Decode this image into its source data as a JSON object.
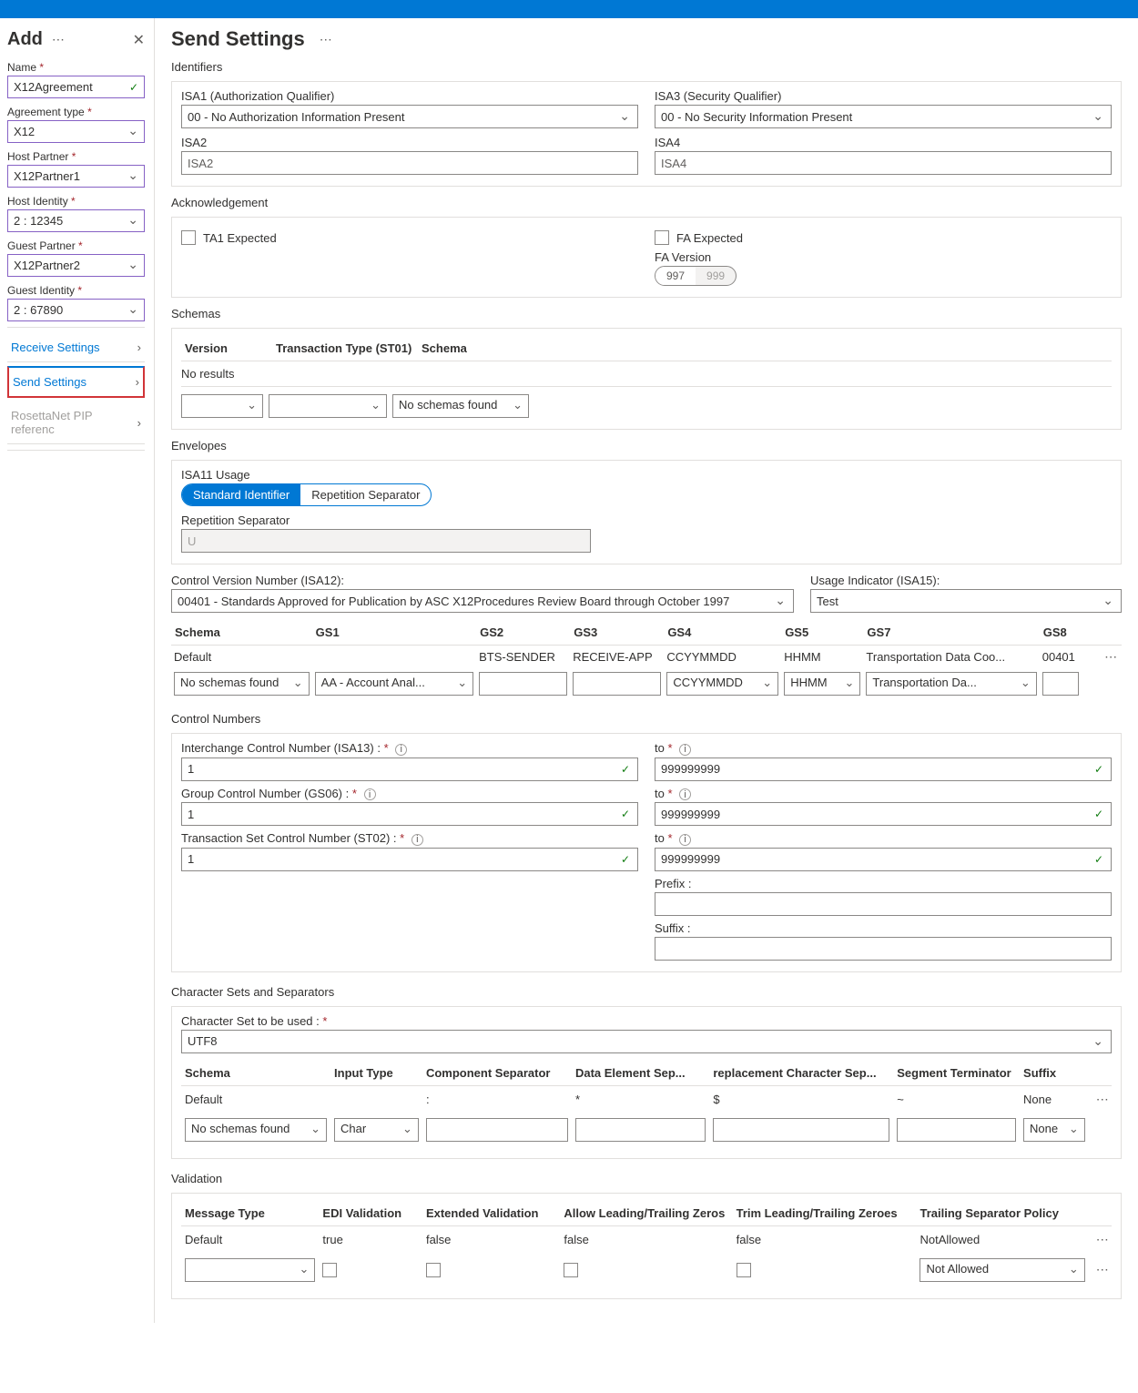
{
  "sidebar": {
    "title": "Add",
    "fields": {
      "name_label": "Name",
      "name_value": "X12Agreement",
      "agreement_type_label": "Agreement type",
      "agreement_type_value": "X12",
      "host_partner_label": "Host Partner",
      "host_partner_value": "X12Partner1",
      "host_identity_label": "Host Identity",
      "host_identity_value": "2 : 12345",
      "guest_partner_label": "Guest Partner",
      "guest_partner_value": "X12Partner2",
      "guest_identity_label": "Guest Identity",
      "guest_identity_value": "2 : 67890"
    },
    "links": {
      "receive": "Receive Settings",
      "send": "Send Settings",
      "rosetta": "RosettaNet PIP referenc"
    }
  },
  "page_title": "Send Settings",
  "identifiers": {
    "section": "Identifiers",
    "isa1_label": "ISA1 (Authorization Qualifier)",
    "isa1_value": "00 - No Authorization Information Present",
    "isa3_label": "ISA3 (Security Qualifier)",
    "isa3_value": "00 - No Security Information Present",
    "isa2_label": "ISA2",
    "isa2_placeholder": "ISA2",
    "isa4_label": "ISA4",
    "isa4_placeholder": "ISA4"
  },
  "ack": {
    "section": "Acknowledgement",
    "ta1": "TA1 Expected",
    "fa": "FA Expected",
    "fa_version_label": "FA Version",
    "opt997": "997",
    "opt999": "999"
  },
  "schemas": {
    "section": "Schemas",
    "col_version": "Version",
    "col_tt": "Transaction Type (ST01)",
    "col_schema": "Schema",
    "no_results": "No results",
    "no_schemas": "No schemas found"
  },
  "envelopes": {
    "section": "Envelopes",
    "isa11_label": "ISA11 Usage",
    "std": "Standard Identifier",
    "rep": "Repetition Separator",
    "rep_sep_label": "Repetition Separator",
    "rep_sep_value": "U",
    "cvn_label": "Control Version Number (ISA12):",
    "cvn_value": "00401 - Standards Approved for Publication by ASC X12Procedures Review Board through October 1997",
    "usage_label": "Usage Indicator (ISA15):",
    "usage_value": "Test",
    "headers": {
      "schema": "Schema",
      "gs1": "GS1",
      "gs2": "GS2",
      "gs3": "GS3",
      "gs4": "GS4",
      "gs5": "GS5",
      "gs7": "GS7",
      "gs8": "GS8"
    },
    "row": {
      "schema": "Default",
      "gs1": "",
      "gs2": "BTS-SENDER",
      "gs3": "RECEIVE-APP",
      "gs4": "CCYYMMDD",
      "gs5": "HHMM",
      "gs7": "Transportation Data Coo...",
      "gs8": "00401"
    },
    "edit": {
      "schema": "No schemas found",
      "gs1": "AA - Account Anal...",
      "gs4": "CCYYMMDD",
      "gs5": "HHMM",
      "gs7": "Transportation Da..."
    }
  },
  "control": {
    "section": "Control Numbers",
    "icn_label": "Interchange Control Number (ISA13) :",
    "gcn_label": "Group Control Number (GS06) :",
    "tscn_label": "Transaction Set Control Number (ST02) :",
    "from": "1",
    "to_label": "to",
    "to": "999999999",
    "prefix_label": "Prefix :",
    "suffix_label": "Suffix :"
  },
  "charset": {
    "section": "Character Sets and Separators",
    "cs_label": "Character Set to be used :",
    "cs_value": "UTF8",
    "headers": {
      "schema": "Schema",
      "input": "Input Type",
      "comp": "Component Separator",
      "data": "Data Element Sep...",
      "repl": "replacement Character Sep...",
      "seg": "Segment Terminator",
      "suffix": "Suffix"
    },
    "row": {
      "schema": "Default",
      "input": "",
      "comp": ":",
      "data": "*",
      "repl": "$",
      "seg": "~",
      "suffix": "None"
    },
    "edit": {
      "schema": "No schemas found",
      "input": "Char",
      "suffix": "None"
    }
  },
  "validation": {
    "section": "Validation",
    "headers": {
      "msg": "Message Type",
      "edi": "EDI Validation",
      "ext": "Extended Validation",
      "lead": "Allow Leading/Trailing Zeros",
      "trim": "Trim Leading/Trailing Zeroes",
      "trail": "Trailing Separator Policy"
    },
    "row": {
      "msg": "Default",
      "edi": "true",
      "ext": "false",
      "lead": "false",
      "trim": "false",
      "trail": "NotAllowed"
    },
    "edit": {
      "trail": "Not Allowed"
    }
  }
}
